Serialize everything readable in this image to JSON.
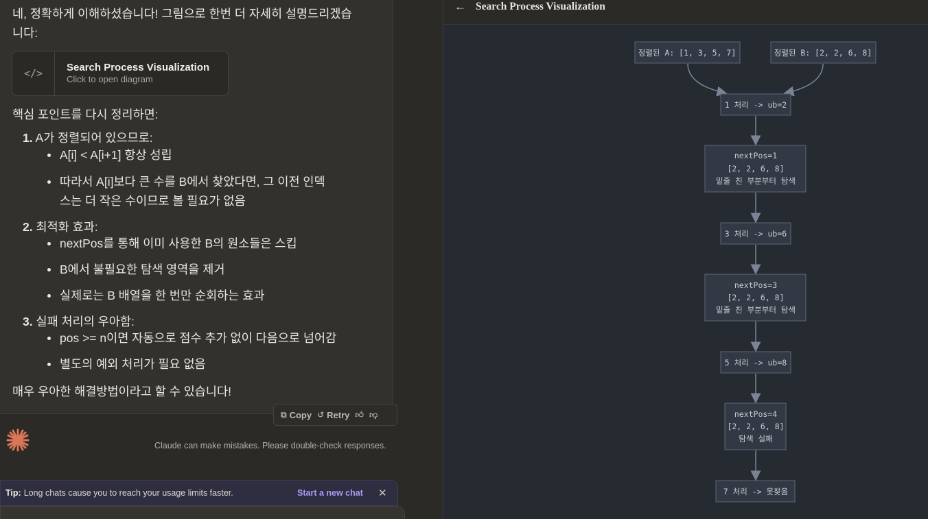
{
  "chat": {
    "intro": "네, 정확하게 이해하셨습니다! 그림으로 한번 더 자세히 설명드리겠습니다:",
    "artifact": {
      "icon": "code-icon",
      "title": "Search Process Visualization",
      "subtitle": "Click to open diagram"
    },
    "summary_heading": "핵심 포인트를 다시 정리하면:",
    "points": [
      {
        "num": "1.",
        "title": "A가 정렬되어 있으므로:",
        "bullets": [
          "A[i] < A[i+1] 항상 성립",
          "따라서 A[i]보다 큰 수를 B에서 찾았다면, 그 이전 인덱",
          "스는 더 작은 수이므로 볼 필요가 없음"
        ]
      },
      {
        "num": "2.",
        "title": "최적화 효과:",
        "bullets": [
          "nextPos를 통해 이미 사용한 B의 원소들은 스킵",
          "B에서 불필요한 탐색 영역을 제거",
          "실제로는 B 배열을 한 번만 순회하는 효과"
        ]
      },
      {
        "num": "3.",
        "title": "실패 처리의 우아함:",
        "bullets": [
          "pos >= n이면 자동으로 점수 추가 없이 다음으로 넘어감",
          "별도의 예외 처리가 필요 없음"
        ]
      }
    ],
    "closing": "매우 우아한 해결방법이라고 할 수 있습니다!",
    "actions": {
      "copy": "Copy",
      "retry": "Retry"
    },
    "disclaimer": "Claude can make mistakes. Please double-check responses."
  },
  "tip": {
    "label": "Tip:",
    "text": "Long chats cause you to reach your usage limits faster.",
    "cta": "Start a new chat"
  },
  "viz": {
    "title": "Search Process Visualization",
    "nodes": {
      "a": "정렬된 A: [1, 3, 5, 7]",
      "b": "정렬된 B: [2, 2, 6, 8]",
      "n1": "1 처리 -> ub=2",
      "p1": [
        "nextPos=1",
        "[2, 2, 6, 8]",
        "밑줄 친 부분부터 탐색"
      ],
      "n3": "3 처리 -> ub=6",
      "p3": [
        "nextPos=3",
        "[2, 2, 6, 8]",
        "밑줄 친 부분부터 탐색"
      ],
      "n5": "5 처리 -> ub=8",
      "p4": [
        "nextPos=4",
        "[2, 2, 6, 8]",
        "탐색 실패"
      ],
      "n7": "7 처리 -> 못찾음"
    }
  },
  "colors": {
    "accent": "#d97757",
    "tip_cta": "#a99af2",
    "node_fill": "#323844",
    "node_stroke": "#5f6877",
    "edge": "#7a8496"
  }
}
